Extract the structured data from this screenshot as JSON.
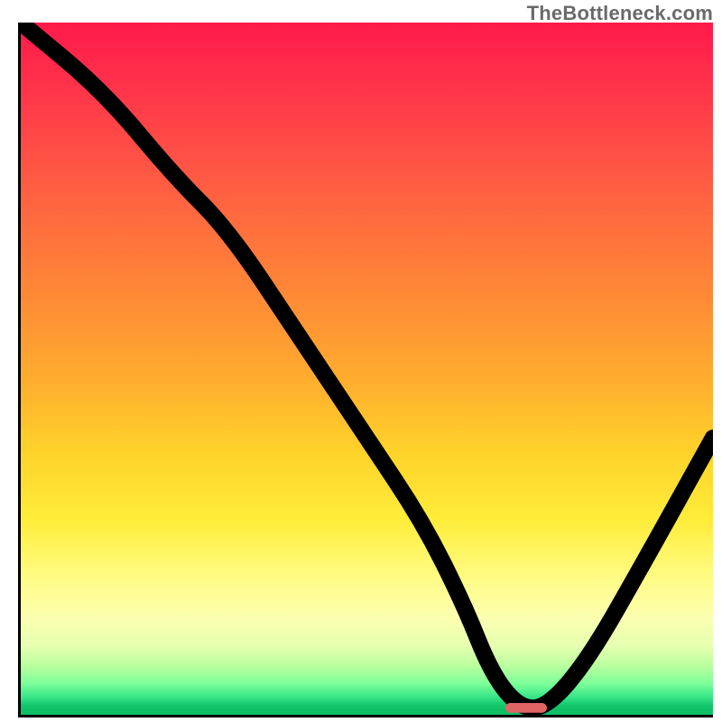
{
  "watermark": {
    "text": "TheBottleneck.com"
  },
  "chart_data": {
    "type": "line",
    "title": "",
    "xlabel": "",
    "ylabel": "",
    "xlim": [
      0,
      100
    ],
    "ylim": [
      0,
      100
    ],
    "grid": false,
    "background": "rainbow-gradient red→green vertical",
    "series": [
      {
        "name": "bottleneck-curve",
        "x": [
          0,
          12,
          22,
          30,
          40,
          50,
          58,
          64,
          68,
          72,
          76,
          82,
          90,
          100
        ],
        "values": [
          100,
          90,
          78,
          70,
          55,
          40,
          28,
          16,
          6,
          1,
          1,
          8,
          22,
          40
        ]
      }
    ],
    "annotations": [
      {
        "name": "optimal-marker",
        "type": "capsule",
        "x_range": [
          70,
          76
        ],
        "y": 1,
        "color": "#e06464"
      }
    ]
  }
}
